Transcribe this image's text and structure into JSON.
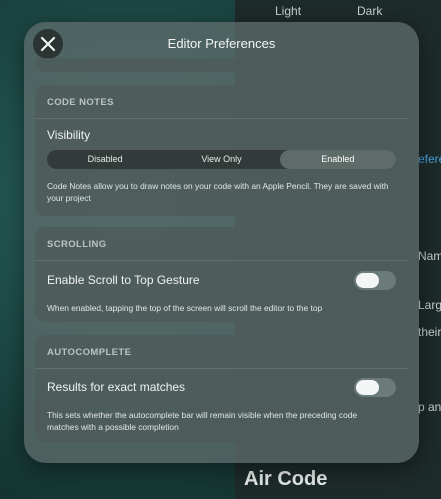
{
  "background": {
    "segments": [
      "Light",
      "Dark"
    ],
    "fragments": [
      "Name",
      "Large",
      "their",
      "eferer",
      "p an"
    ],
    "app_title": "Air Code"
  },
  "modal": {
    "title": "Editor Preferences",
    "close_icon": "close-icon"
  },
  "code_notes": {
    "header": "CODE NOTES",
    "visibility_label": "Visibility",
    "options": [
      "Disabled",
      "View Only",
      "Enabled"
    ],
    "selected": "Enabled",
    "description": "Code Notes allow you to draw notes on your code with an Apple Pencil. They are saved with your project"
  },
  "scrolling": {
    "header": "SCROLLING",
    "toggle_label": "Enable Scroll to Top Gesture",
    "toggle_on": false,
    "description": "When enabled, tapping the top of the screen will scroll the editor to the top"
  },
  "autocomplete": {
    "header": "AUTOCOMPLETE",
    "toggle_label": "Results for exact matches",
    "toggle_on": false,
    "description": "This sets whether the autocomplete bar will remain visible when the preceding code matches with a possible completion"
  }
}
